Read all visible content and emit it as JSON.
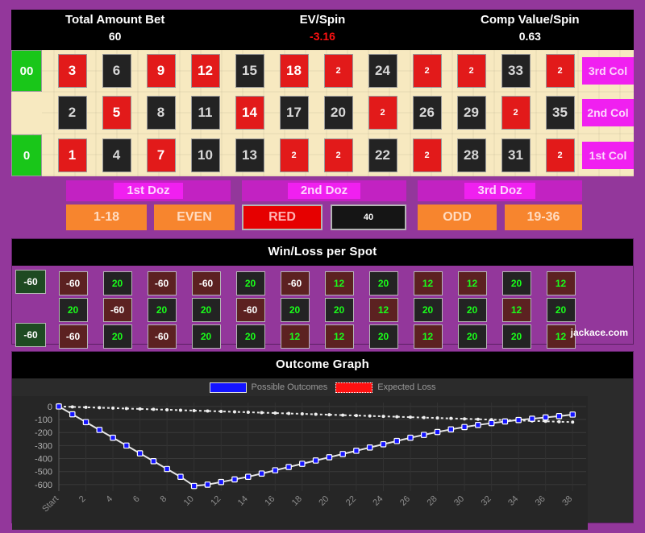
{
  "header": {
    "stats": [
      {
        "label": "Total Amount Bet",
        "value": "60",
        "negative": false
      },
      {
        "label": "EV/Spin",
        "value": "-3.16",
        "negative": true
      },
      {
        "label": "Comp Value/Spin",
        "value": "0.63",
        "negative": false
      }
    ]
  },
  "board": {
    "zero_top": "00",
    "zero_bottom": "0",
    "row3": [
      {
        "text": "3",
        "color": "red",
        "bet": false
      },
      {
        "text": "6",
        "color": "black",
        "bet": false
      },
      {
        "text": "9",
        "color": "red",
        "bet": false
      },
      {
        "text": "12",
        "color": "red",
        "bet": false
      },
      {
        "text": "15",
        "color": "black",
        "bet": false
      },
      {
        "text": "18",
        "color": "red",
        "bet": false
      },
      {
        "text": "2",
        "color": "red",
        "bet": true
      },
      {
        "text": "24",
        "color": "black",
        "bet": false
      },
      {
        "text": "2",
        "color": "red",
        "bet": true
      },
      {
        "text": "2",
        "color": "red",
        "bet": true
      },
      {
        "text": "33",
        "color": "black",
        "bet": false
      },
      {
        "text": "2",
        "color": "red",
        "bet": true
      }
    ],
    "row2": [
      {
        "text": "2",
        "color": "black",
        "bet": false
      },
      {
        "text": "5",
        "color": "red",
        "bet": false
      },
      {
        "text": "8",
        "color": "black",
        "bet": false
      },
      {
        "text": "11",
        "color": "black",
        "bet": false
      },
      {
        "text": "14",
        "color": "red",
        "bet": false
      },
      {
        "text": "17",
        "color": "black",
        "bet": false
      },
      {
        "text": "20",
        "color": "black",
        "bet": false
      },
      {
        "text": "2",
        "color": "red",
        "bet": true
      },
      {
        "text": "26",
        "color": "black",
        "bet": false
      },
      {
        "text": "29",
        "color": "black",
        "bet": false
      },
      {
        "text": "2",
        "color": "red",
        "bet": true
      },
      {
        "text": "35",
        "color": "black",
        "bet": false
      }
    ],
    "row1": [
      {
        "text": "1",
        "color": "red",
        "bet": false
      },
      {
        "text": "4",
        "color": "black",
        "bet": false
      },
      {
        "text": "7",
        "color": "red",
        "bet": false
      },
      {
        "text": "10",
        "color": "black",
        "bet": false
      },
      {
        "text": "13",
        "color": "black",
        "bet": false
      },
      {
        "text": "2",
        "color": "red",
        "bet": true
      },
      {
        "text": "2",
        "color": "red",
        "bet": true
      },
      {
        "text": "22",
        "color": "black",
        "bet": false
      },
      {
        "text": "2",
        "color": "red",
        "bet": true
      },
      {
        "text": "28",
        "color": "black",
        "bet": false
      },
      {
        "text": "31",
        "color": "black",
        "bet": false
      },
      {
        "text": "2",
        "color": "red",
        "bet": true
      }
    ],
    "columns": [
      {
        "label": "3rd Col"
      },
      {
        "label": "2nd Col"
      },
      {
        "label": "1st Col"
      }
    ]
  },
  "dozens": [
    {
      "label": "1st Doz"
    },
    {
      "label": "2nd Doz"
    },
    {
      "label": "3rd Doz"
    }
  ],
  "outside_bets": [
    {
      "label": "1-18",
      "style": "orange"
    },
    {
      "label": "EVEN",
      "style": "orange"
    },
    {
      "label": "RED",
      "style": "red"
    },
    {
      "label": "40",
      "style": "black"
    },
    {
      "label": "ODD",
      "style": "orange"
    },
    {
      "label": "19-36",
      "style": "orange"
    }
  ],
  "winloss": {
    "title": "Win/Loss per Spot",
    "brand": "jackace.com",
    "zero_top": "-60",
    "zero_bottom": "-60",
    "row3": [
      {
        "text": "-60",
        "color": "red",
        "win": false
      },
      {
        "text": "20",
        "color": "black",
        "win": true
      },
      {
        "text": "-60",
        "color": "red",
        "win": false
      },
      {
        "text": "-60",
        "color": "red",
        "win": false
      },
      {
        "text": "20",
        "color": "black",
        "win": true
      },
      {
        "text": "-60",
        "color": "red",
        "win": false
      },
      {
        "text": "12",
        "color": "red",
        "win": true
      },
      {
        "text": "20",
        "color": "black",
        "win": true
      },
      {
        "text": "12",
        "color": "red",
        "win": true
      },
      {
        "text": "12",
        "color": "red",
        "win": true
      },
      {
        "text": "20",
        "color": "black",
        "win": true
      },
      {
        "text": "12",
        "color": "red",
        "win": true
      }
    ],
    "row2": [
      {
        "text": "20",
        "color": "black",
        "win": true
      },
      {
        "text": "-60",
        "color": "red",
        "win": false
      },
      {
        "text": "20",
        "color": "black",
        "win": true
      },
      {
        "text": "20",
        "color": "black",
        "win": true
      },
      {
        "text": "-60",
        "color": "red",
        "win": false
      },
      {
        "text": "20",
        "color": "black",
        "win": true
      },
      {
        "text": "20",
        "color": "black",
        "win": true
      },
      {
        "text": "12",
        "color": "red",
        "win": true
      },
      {
        "text": "20",
        "color": "black",
        "win": true
      },
      {
        "text": "20",
        "color": "black",
        "win": true
      },
      {
        "text": "12",
        "color": "red",
        "win": true
      },
      {
        "text": "20",
        "color": "black",
        "win": true
      }
    ],
    "row1": [
      {
        "text": "-60",
        "color": "red",
        "win": false
      },
      {
        "text": "20",
        "color": "black",
        "win": true
      },
      {
        "text": "-60",
        "color": "red",
        "win": false
      },
      {
        "text": "20",
        "color": "black",
        "win": true
      },
      {
        "text": "20",
        "color": "black",
        "win": true
      },
      {
        "text": "12",
        "color": "red",
        "win": true
      },
      {
        "text": "12",
        "color": "red",
        "win": true
      },
      {
        "text": "20",
        "color": "black",
        "win": true
      },
      {
        "text": "12",
        "color": "red",
        "win": true
      },
      {
        "text": "20",
        "color": "black",
        "win": true
      },
      {
        "text": "20",
        "color": "black",
        "win": true
      },
      {
        "text": "12",
        "color": "red",
        "win": true
      }
    ]
  },
  "chart_data": {
    "type": "line",
    "title": "Outcome Graph",
    "xlabel": "",
    "ylabel": "",
    "grid": true,
    "legend_position": "top",
    "xlim": [
      0,
      39
    ],
    "ylim": [
      -650,
      30
    ],
    "yticks": [
      0,
      -100,
      -200,
      -300,
      -400,
      -500,
      -600
    ],
    "xticks": [
      "Start",
      "2",
      "4",
      "6",
      "8",
      "10",
      "12",
      "14",
      "16",
      "18",
      "20",
      "22",
      "24",
      "26",
      "28",
      "30",
      "32",
      "34",
      "36",
      "38"
    ],
    "series": [
      {
        "name": "Possible Outcomes",
        "color": "#1414ff",
        "x": [
          0,
          1,
          2,
          3,
          4,
          5,
          6,
          7,
          8,
          9,
          10,
          11,
          12,
          13,
          14,
          15,
          16,
          17,
          18,
          19,
          20,
          21,
          22,
          23,
          24,
          25,
          26,
          27,
          28,
          29,
          30,
          31,
          32,
          33,
          34,
          35,
          36,
          37,
          38
        ],
        "values": [
          0,
          -60,
          -120,
          -180,
          -240,
          -300,
          -360,
          -420,
          -480,
          -540,
          -610,
          -600,
          -580,
          -560,
          -540,
          -515,
          -490,
          -465,
          -440,
          -415,
          -390,
          -365,
          -340,
          -315,
          -290,
          -265,
          -240,
          -218,
          -196,
          -176,
          -158,
          -142,
          -128,
          -115,
          -104,
          -94,
          -84,
          -74,
          -62
        ]
      },
      {
        "name": "Expected Loss",
        "color": "#ff1111",
        "x": [
          0,
          1,
          2,
          3,
          4,
          5,
          6,
          7,
          8,
          9,
          10,
          11,
          12,
          13,
          14,
          15,
          16,
          17,
          18,
          19,
          20,
          21,
          22,
          23,
          24,
          25,
          26,
          27,
          28,
          29,
          30,
          31,
          32,
          33,
          34,
          35,
          36,
          37,
          38
        ],
        "values": [
          0,
          -3.16,
          -6.3,
          -9.5,
          -12.6,
          -15.8,
          -19,
          -22.1,
          -25.3,
          -28.4,
          -31.6,
          -34.8,
          -37.9,
          -41.1,
          -44.2,
          -47.4,
          -50.6,
          -53.7,
          -56.9,
          -60,
          -63.2,
          -66.4,
          -69.5,
          -72.7,
          -75.8,
          -79,
          -82.2,
          -85.3,
          -88.5,
          -91.6,
          -94.8,
          -98,
          -101.1,
          -104.3,
          -107.4,
          -110.6,
          -113.8,
          -116.9,
          -120.1
        ]
      }
    ]
  }
}
